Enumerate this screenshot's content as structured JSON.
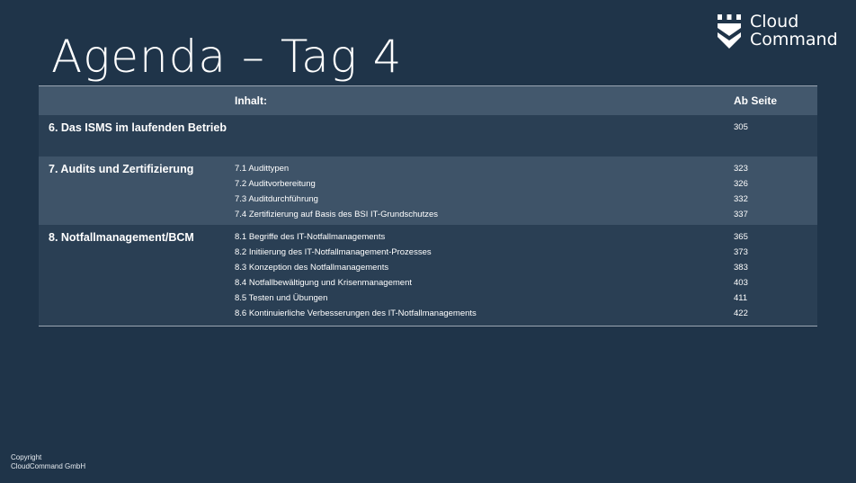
{
  "slide": {
    "title": "Agenda – Tag 4",
    "logo": {
      "line1": "Cloud",
      "line2": "Command",
      "icon": "shield-crown-icon"
    },
    "table": {
      "header": {
        "inhalt": "Inhalt:",
        "ab_seite": "Ab Seite"
      },
      "sections": [
        {
          "title": "6. Das ISMS im laufenden Betrieb",
          "items": [
            {
              "label": "",
              "page": "305"
            }
          ]
        },
        {
          "title": "7. Audits und Zertifizierung",
          "items": [
            {
              "label": "7.1 Audittypen",
              "page": "323"
            },
            {
              "label": "7.2 Auditvorbereitung",
              "page": "326"
            },
            {
              "label": "7.3 Auditdurchführung",
              "page": "332"
            },
            {
              "label": "7.4 Zertifizierung auf Basis des BSI IT-Grundschutzes",
              "page": "337"
            }
          ]
        },
        {
          "title": "8. Notfallmanagement/BCM",
          "items": [
            {
              "label": "8.1 Begriffe des IT-Notfallmanagements",
              "page": "365"
            },
            {
              "label": "8.2 Initiierung des IT-Notfallmanagement-Prozesses",
              "page": "373"
            },
            {
              "label": "8.3 Konzeption des Notfallmanagements",
              "page": "383"
            },
            {
              "label": "8.4 Notfallbewältigung und Krisenmanagement",
              "page": "403"
            },
            {
              "label": "8.5 Testen und Übungen",
              "page": "411"
            },
            {
              "label": "8.6 Kontinuierliche Verbesserungen des IT-Notfallmanagements",
              "page": "422"
            }
          ]
        }
      ]
    },
    "copyright": {
      "line1": "Copyright",
      "line2": "CloudCommand GmbH"
    },
    "colors": {
      "background": "#1f3449",
      "header_row": "#43586d",
      "row_light": "#3e5368",
      "row_dark": "#2a3f54",
      "text": "#ffffff"
    }
  }
}
